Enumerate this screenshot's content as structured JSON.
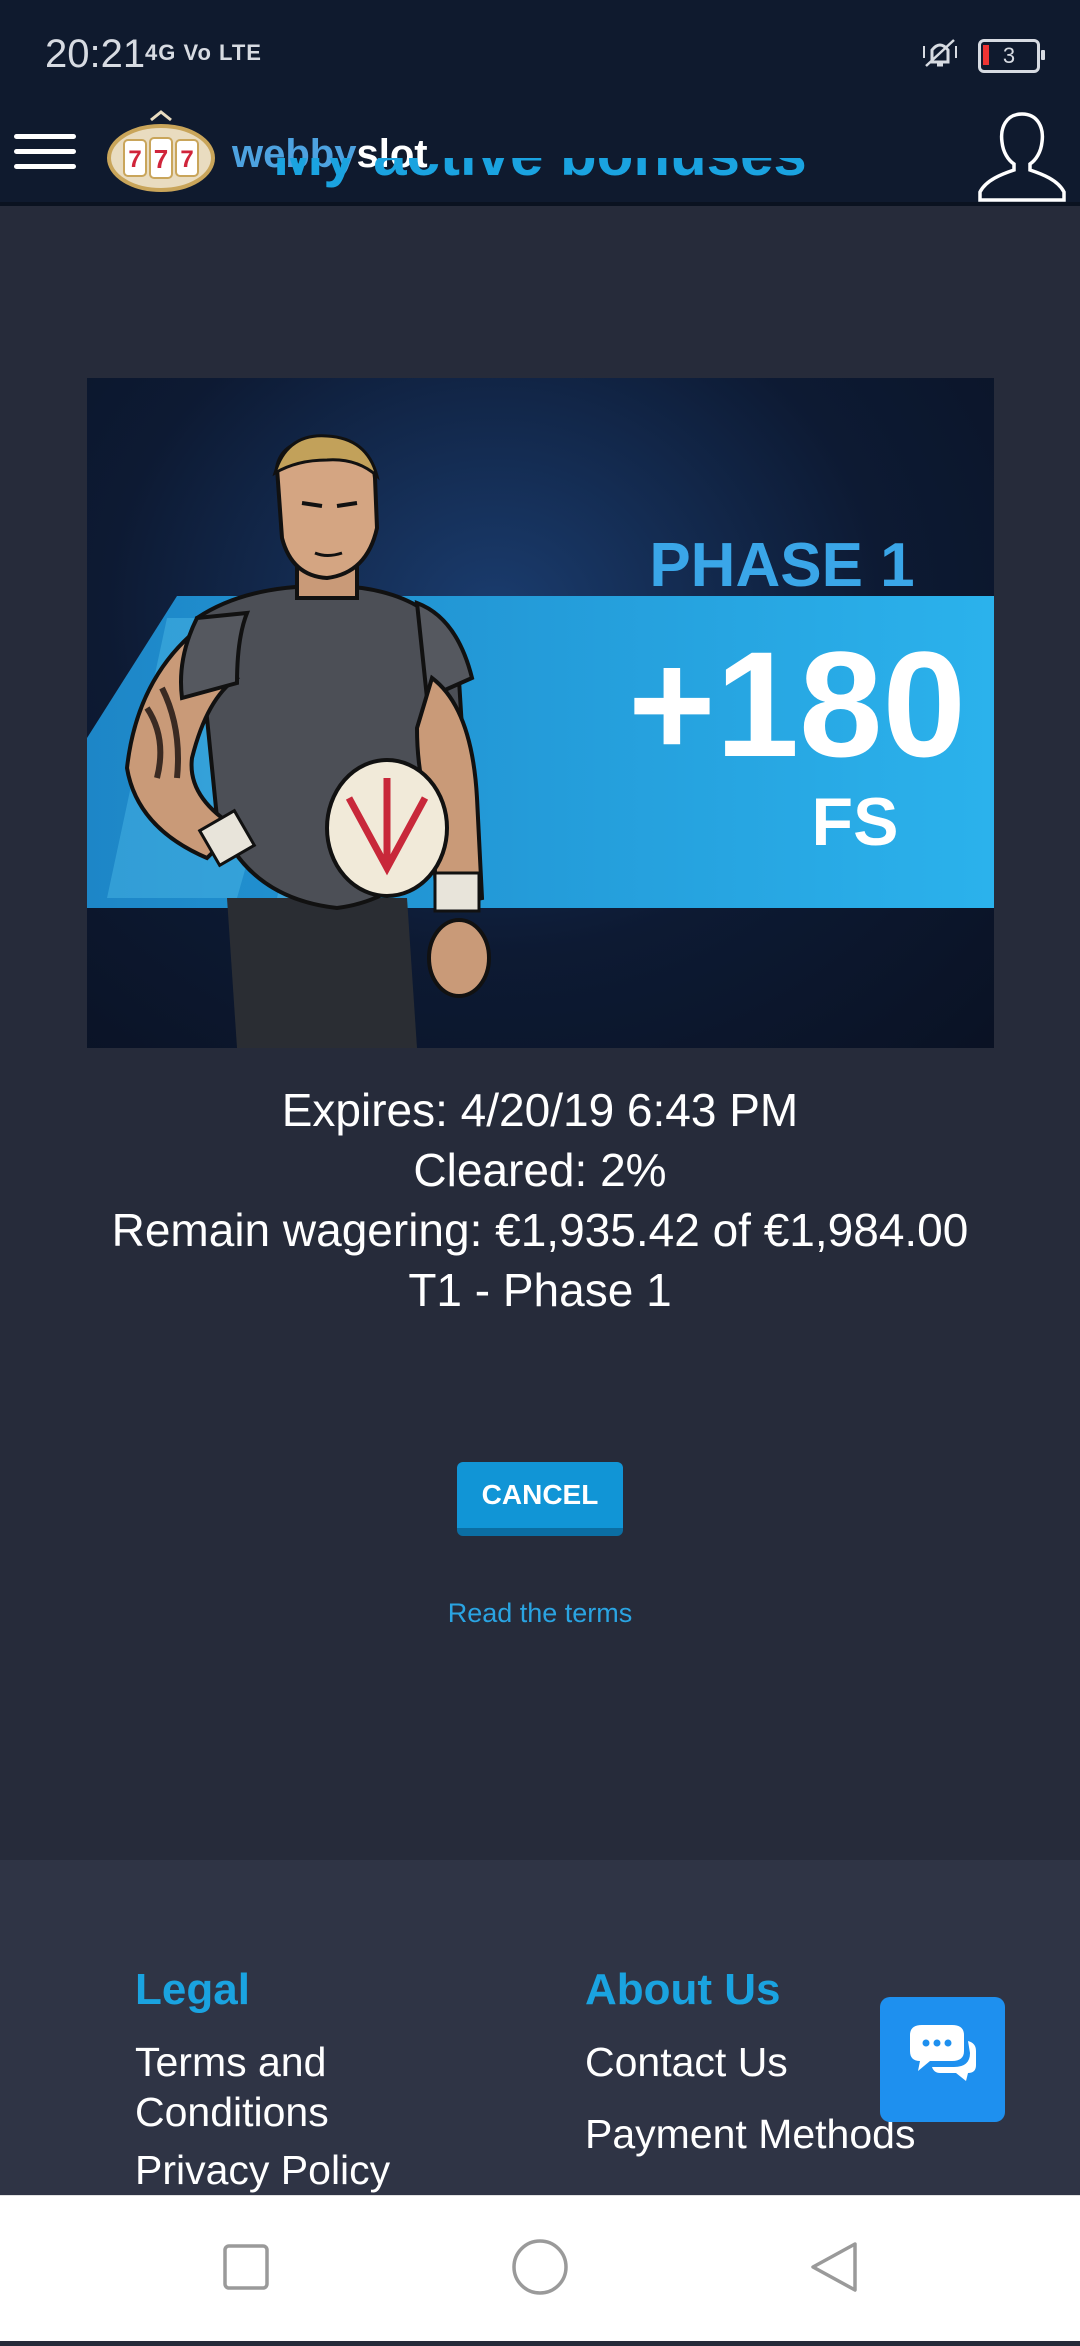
{
  "status_bar": {
    "time": "20:21",
    "network": "4G Vo LTE",
    "battery": "3"
  },
  "header": {
    "brand_part1": "webby",
    "brand_part2": "slot",
    "logo_reels": [
      "7",
      "7",
      "7"
    ]
  },
  "page": {
    "section_title": "My active bonuses"
  },
  "bonus": {
    "banner_phase": "PHASE 1",
    "banner_amount": "+180",
    "banner_unit": "FS",
    "expires": "Expires: 4/20/19 6:43 PM",
    "cleared": "Cleared: 2%",
    "remain": "Remain wagering: €1,935.42 of €1,984.00",
    "tier": "T1 - Phase 1",
    "cancel_label": "CANCEL",
    "terms_label": "Read the terms"
  },
  "footer": {
    "legal_title": "Legal",
    "legal_items": [
      "Terms and Conditions",
      "Privacy Policy"
    ],
    "about_title": "About Us",
    "about_items": [
      "Contact Us",
      "Payment Methods"
    ]
  },
  "colors": {
    "accent": "#1aa3e0",
    "background": "#262b3a",
    "header_bg": "#0f1a2e",
    "chat_button": "#1e90ef"
  },
  "icons": {
    "menu": "hamburger-icon",
    "user": "user-icon",
    "chat": "chat-bubbles-icon",
    "nav_recent": "square-icon",
    "nav_home": "circle-icon",
    "nav_back": "triangle-back-icon"
  }
}
